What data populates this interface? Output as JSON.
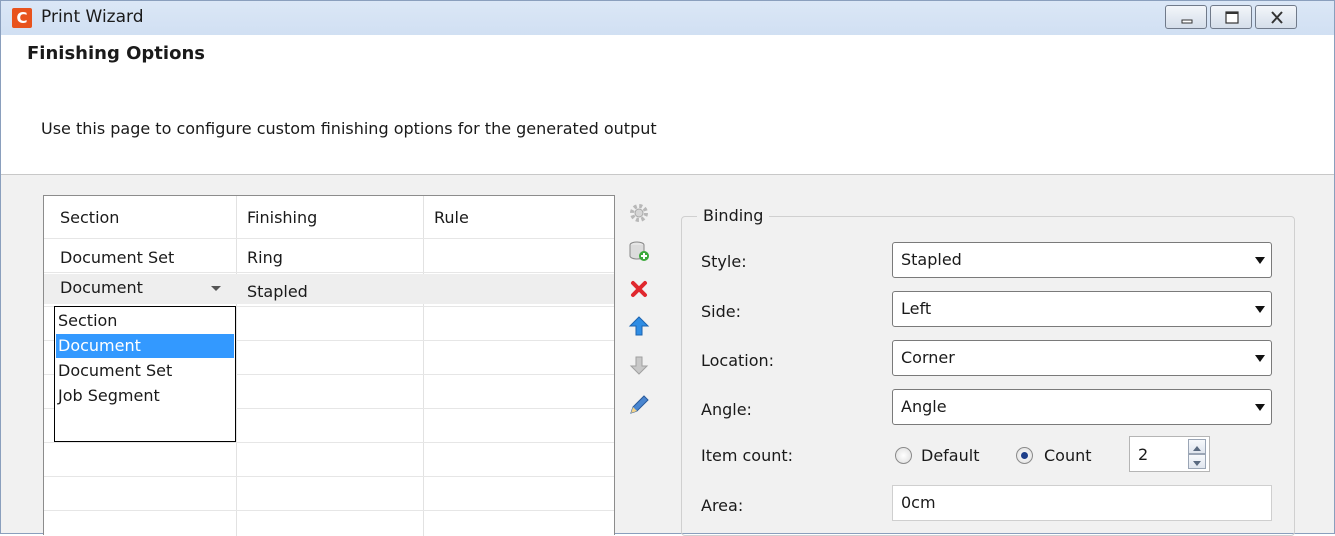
{
  "window": {
    "app_icon_letter": "C",
    "title": "Print Wizard"
  },
  "header": {
    "page_title": "Finishing Options",
    "description": "Use this page to configure custom finishing options for the generated output"
  },
  "table": {
    "columns": [
      "Section",
      "Finishing",
      "Rule"
    ],
    "rows": [
      {
        "section": "Document Set",
        "finishing": "Ring",
        "rule": ""
      },
      {
        "section": "Document",
        "finishing": "Stapled",
        "rule": ""
      }
    ],
    "dropdown_options": [
      "Section",
      "Document",
      "Document Set",
      "Job Segment"
    ],
    "dropdown_selected": "Document"
  },
  "toolbar": {
    "icons": [
      "gear-icon",
      "add-database-icon",
      "delete-icon",
      "move-up-icon",
      "move-down-icon",
      "edit-pencil-icon"
    ]
  },
  "binding": {
    "group_title": "Binding",
    "style_label": "Style:",
    "style_value": "Stapled",
    "side_label": "Side:",
    "side_value": "Left",
    "location_label": "Location:",
    "location_value": "Corner",
    "angle_label": "Angle:",
    "angle_value": "Angle",
    "item_count_label": "Item count:",
    "default_option": "Default",
    "count_option": "Count",
    "count_selected": "Count",
    "count_value": "2",
    "area_label": "Area:",
    "area_value": "0cm"
  },
  "colors": {
    "accent_selection": "#3399ff",
    "app_icon": "#e8531d",
    "delete_icon": "#e0282e",
    "arrow_up": "#2f8de4",
    "title_bar": "#c9daf0"
  }
}
